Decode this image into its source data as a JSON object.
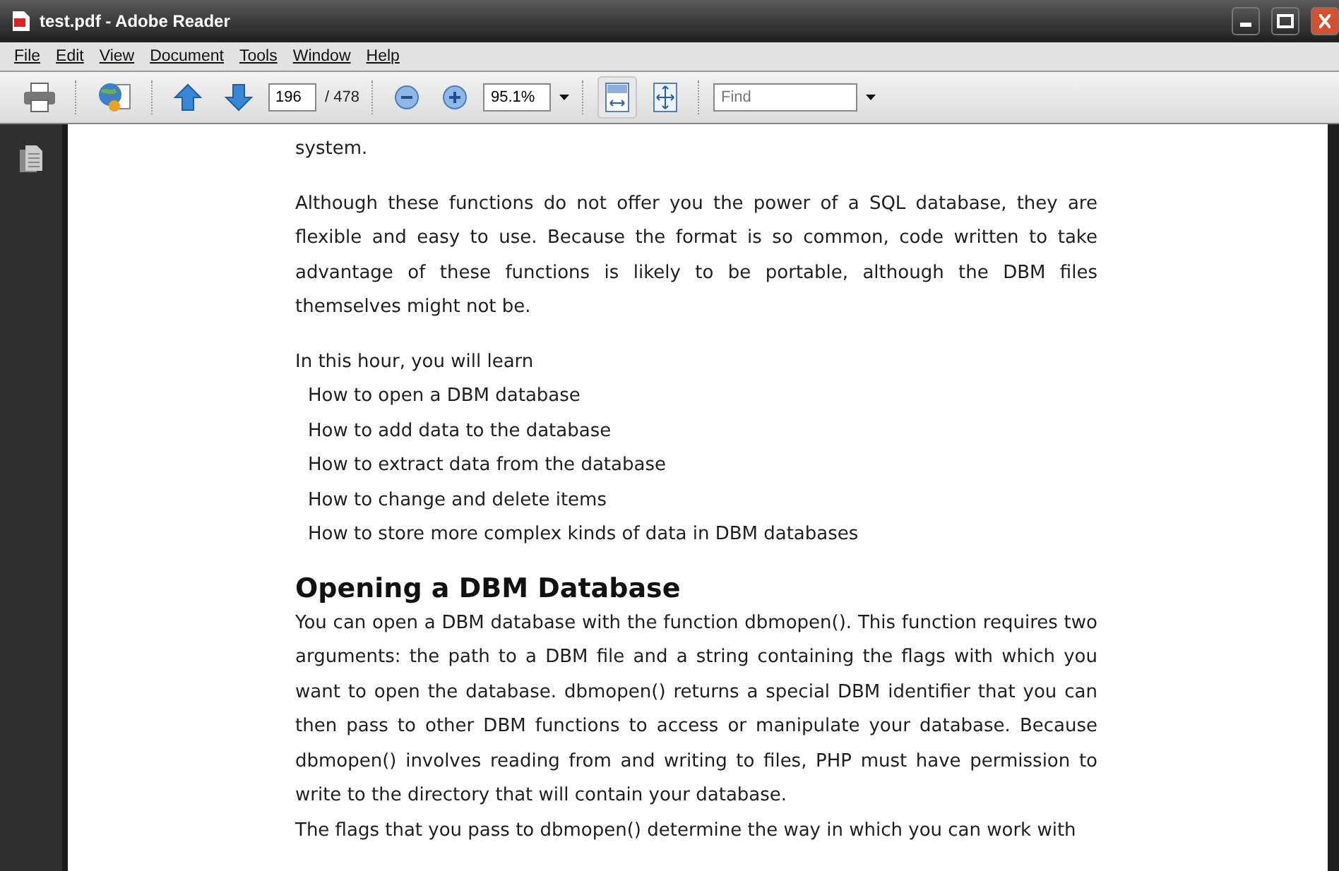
{
  "window": {
    "title": "test.pdf - Adobe Reader"
  },
  "menu": [
    "File",
    "Edit",
    "View",
    "Document",
    "Tools",
    "Window",
    "Help"
  ],
  "toolbar": {
    "page_number": "196",
    "page_total": "/ 478",
    "zoom": "95.1%",
    "view_buttons": [
      {
        "kind": "fit-width",
        "selected": true
      },
      {
        "kind": "fit-page",
        "selected": false
      }
    ],
    "find": {
      "placeholder": "Find"
    }
  },
  "document": {
    "blocks": [
      {
        "kind": "paragraph",
        "text": "system."
      },
      {
        "kind": "paragraph",
        "text": "Although these functions do not offer you the power of a SQL database, they are flexible and easy to use. Because the format is so common, code written to take advantage of these functions is likely to be portable, although the DBM files themselves might not be."
      },
      {
        "kind": "list",
        "intro": "In this hour, you will learn",
        "items": [
          "How to open a DBM database",
          "How to add data to the database",
          "How to extract data from the database",
          "How to change and delete items",
          "How to store more complex kinds of data in DBM databases"
        ]
      },
      {
        "kind": "heading",
        "text": "Opening a DBM Database"
      },
      {
        "kind": "tight",
        "text": "You can open a DBM database with the function dbmopen(). This function requires two arguments: the path to a DBM file and a string containing the flags with which you want to open the database. dbmopen() returns a special DBM identifier that you can then pass to other DBM functions to access or manipulate your database. Because dbmopen() involves reading from and writing to files, PHP must have permission to write to the directory that will contain your database."
      },
      {
        "kind": "tight",
        "text": "The flags that you pass to dbmopen() determine the way in which you can work with"
      }
    ]
  }
}
